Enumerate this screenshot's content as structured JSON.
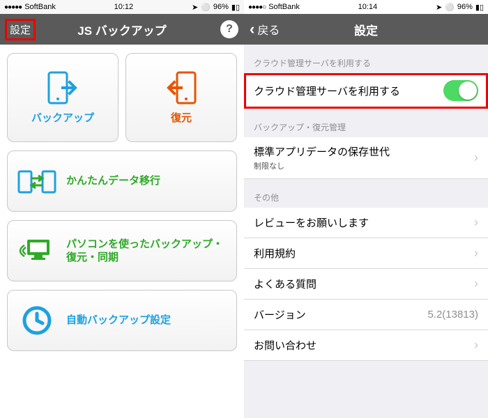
{
  "screen1": {
    "status": {
      "carrier": "SoftBank",
      "time": "10:12",
      "battery": "96%"
    },
    "nav": {
      "settings": "設定",
      "title": "JS バックアップ",
      "help": "?"
    },
    "backup_label": "バックアップ",
    "restore_label": "復元",
    "easy_transfer_label": "かんたんデータ移行",
    "pc_backup_label": "パソコンを使ったバックアップ・復元・同期",
    "auto_backup_label": "自動バックアップ設定"
  },
  "screen2": {
    "status": {
      "carrier": "SoftBank",
      "time": "10:14",
      "battery": "96%"
    },
    "nav": {
      "back": "戻る",
      "title": "設定"
    },
    "section_cloud": "クラウド管理サーバを利用する",
    "cloud_toggle_label": "クラウド管理サーバを利用する",
    "section_backup": "バックアップ・復元管理",
    "generations_label": "標準アプリデータの保存世代",
    "generations_sub": "制限なし",
    "section_other": "その他",
    "review_label": "レビューをお願いします",
    "terms_label": "利用規約",
    "faq_label": "よくある質問",
    "version_label": "バージョン",
    "version_value": "5.2(13813)",
    "contact_label": "お問い合わせ"
  }
}
